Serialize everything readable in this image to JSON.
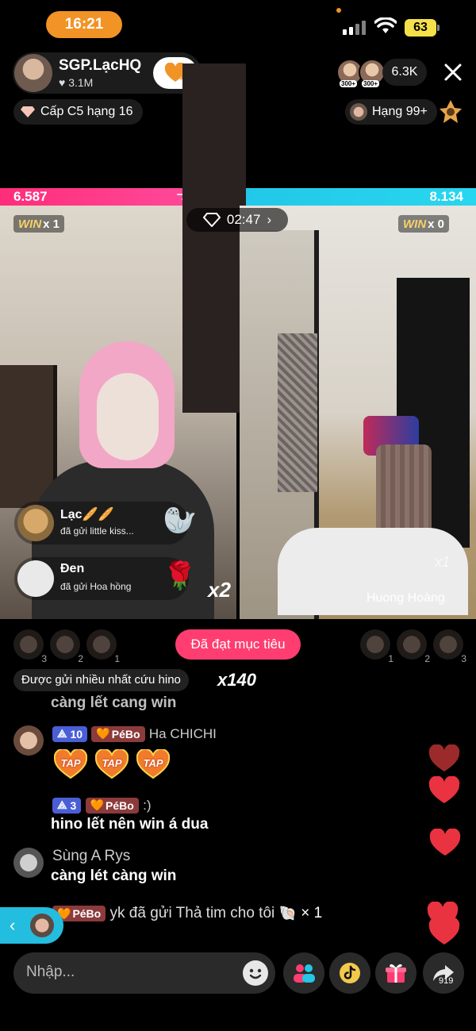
{
  "status": {
    "time": "16:21",
    "battery": "63"
  },
  "host": {
    "name": "SGP.LạcHQ",
    "likes": "3.1M",
    "follow_count": "1"
  },
  "viewers": {
    "count": "6.3K",
    "badges": [
      "300+",
      "300+"
    ]
  },
  "level": {
    "text": "Cấp C5 hạng 16"
  },
  "rank": {
    "text": "Hạng 99+"
  },
  "battle": {
    "score_left": "6.587",
    "score_right": "8.134",
    "timer": "02:47",
    "win_left": "x 1",
    "win_right": "x 0",
    "win_word": "WIN",
    "right_streamer": "Huong Hoàng",
    "right_multiplier": "x1",
    "combo": "x2"
  },
  "gift_toasts": [
    {
      "name": "Lạc🥖🥖",
      "text": "đã gửi little kiss...",
      "gift": "🦭"
    },
    {
      "name": "Đen",
      "text": "đã gửi Hoa hồng",
      "gift": "🌹"
    }
  ],
  "supporters_left": [
    "3",
    "2",
    "1"
  ],
  "supporters_right": [
    "1",
    "2",
    "3"
  ],
  "goal_button": "Đã đạt mục tiêu",
  "most_sent": {
    "text": "Được gửi nhiều nhất cứu hino",
    "count": "x140"
  },
  "chat": {
    "faded": "càng lết cang win",
    "msg1": {
      "level": "10",
      "fan": "PéBo",
      "name": "Ha CHICHI",
      "tap_label": "TAP"
    },
    "msg2": {
      "level": "3",
      "fan": "PéBo",
      "name": ":)",
      "text": "hino lết nên win á dua"
    },
    "msg3": {
      "name": "Sùng A Rys",
      "text": "càng lét càng win"
    },
    "msg4": {
      "fan": "PéBo",
      "text": "yk đã gửi Thả tim cho tôi",
      "count": "× 1"
    }
  },
  "input": {
    "placeholder": "Nhập..."
  },
  "share": {
    "count": "919"
  },
  "colors": {
    "accent": "#ff3d71",
    "left_team": "#ff2d7a",
    "right_team": "#21c6e6",
    "time_pill": "#f29326"
  }
}
